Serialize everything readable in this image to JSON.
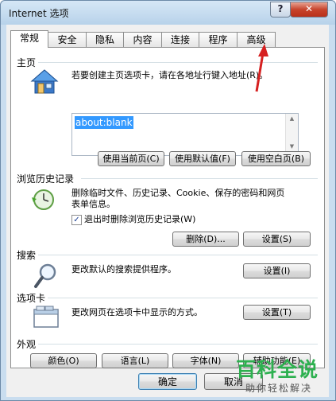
{
  "window": {
    "title": "Internet 选项",
    "help_label": "?",
    "close_label": "✕"
  },
  "tabs": [
    {
      "label": "常规",
      "active": true
    },
    {
      "label": "安全"
    },
    {
      "label": "隐私"
    },
    {
      "label": "内容"
    },
    {
      "label": "连接"
    },
    {
      "label": "程序"
    },
    {
      "label": "高级"
    }
  ],
  "home": {
    "title": "主页",
    "desc": "若要创建主页选项卡，请在各地址行键入地址(R)。",
    "url": "about:blank",
    "buttons": [
      "使用当前页(C)",
      "使用默认值(F)",
      "使用空白页(B)"
    ]
  },
  "history": {
    "title": "浏览历史记录",
    "desc_line1": "删除临时文件、历史记录、Cookie、保存的密码和网页",
    "desc_line2": "表单信息。",
    "checkbox_label": "退出时删除浏览历史记录(W)",
    "checkbox_checked": true,
    "delete_button": "删除(D)...",
    "settings_button": "设置(S)"
  },
  "search": {
    "title": "搜索",
    "desc": "更改默认的搜索提供程序。",
    "settings_button": "设置(I)"
  },
  "tabs_section": {
    "title": "选项卡",
    "desc": "更改网页在选项卡中显示的方式。",
    "settings_button": "设置(T)"
  },
  "appearance": {
    "title": "外观",
    "buttons": [
      "颜色(O)",
      "语言(L)",
      "字体(N)",
      "辅助功能(E)"
    ]
  },
  "bottom": {
    "ok_label": "确定",
    "cancel_label": "取消"
  },
  "watermark": {
    "title": "百科全说",
    "subtitle": "助你轻松解决"
  },
  "colors": {
    "annotation_arrow": "#d62020",
    "watermark_green": "#2db04f"
  }
}
